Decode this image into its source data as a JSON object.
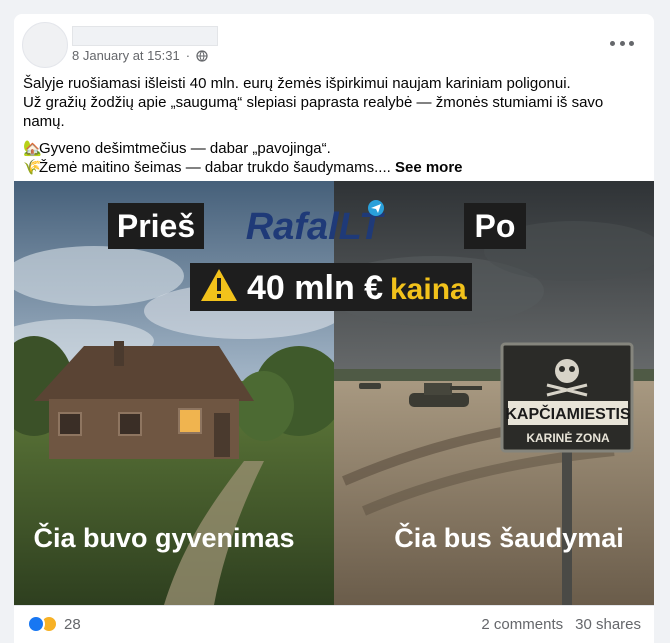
{
  "post": {
    "timestamp": "8 January at 15:31",
    "separator": "·",
    "text": {
      "line1": "Šalyje ruošiamasi išleisti 40 mln. eurų žemės išpirkimui naujam kariniam poligonui.",
      "line2": "Už gražių žodžių apie „saugumą“ slepiasi paprasta realybė — žmonės stumiami iš savo namų.",
      "line3": "Gyveno dešimtmečius — dabar „pavojinga“.",
      "line4": "Žemė maitino šeimas — dabar trukdo šaudymams....",
      "see_more": "See more"
    },
    "image": {
      "label_before": "Prieš",
      "label_after": "Po",
      "logo": "RafalLT",
      "price_amount": "40 mln €",
      "price_word": "kaina",
      "sign_top": "KAPČIAMIESTIS",
      "sign_bottom": "KARINĖ ZONA",
      "caption_left": "Čia buvo gyvenimas",
      "caption_right": "Čia bus šaudymai"
    },
    "footer": {
      "reaction_count": "28",
      "comments": "2 comments",
      "shares": "30 shares"
    }
  },
  "icons": {
    "globe": "globe-icon",
    "more": "more-options-icon",
    "house": "house-emoji-icon",
    "wheat": "wheat-emoji-icon",
    "like": "like-reaction-icon",
    "sad": "sad-reaction-icon",
    "warning": "warning-icon",
    "telegram": "telegram-icon"
  },
  "colors": {
    "accent_yellow": "#f2c21b",
    "reaction_blue": "#1877f2",
    "reaction_yellow": "#f7b125",
    "muted_text": "#65676b"
  }
}
